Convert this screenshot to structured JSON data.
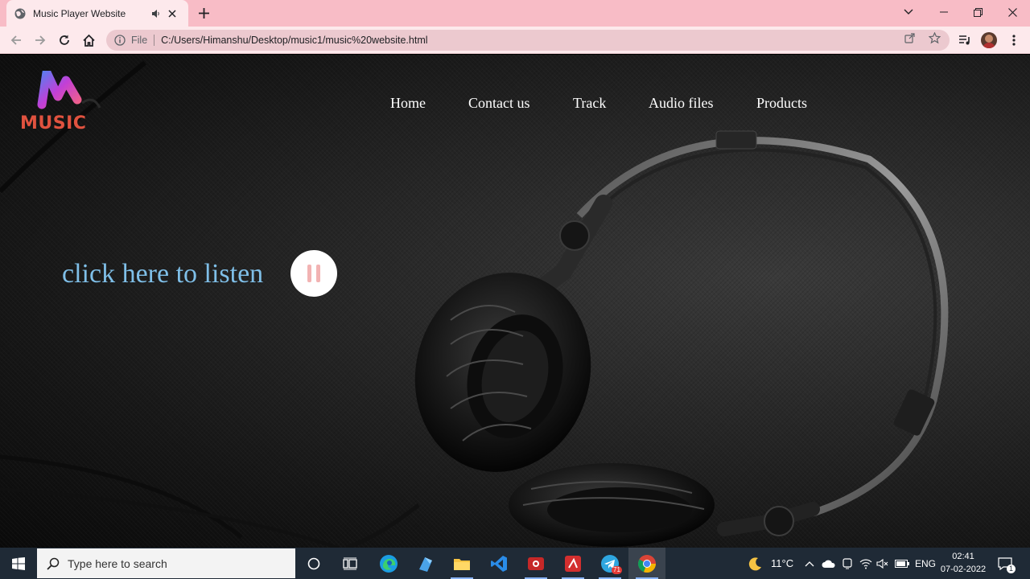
{
  "browser": {
    "tab_title": "Music Player Website",
    "file_label": "File",
    "url": "C:/Users/Himanshu/Desktop/music1/music%20website.html"
  },
  "page": {
    "logo_text": "MUSIC",
    "nav": [
      "Home",
      "Contact us",
      "Track",
      "Audio files",
      "Products"
    ],
    "cta_text": "click here to listen",
    "colors": {
      "cta": "#7fbfe8",
      "logo_text": "#e0523f",
      "chrome": "#f8bcc6"
    }
  },
  "taskbar": {
    "search_placeholder": "Type here to search",
    "weather": "11°C",
    "language": "ENG",
    "time": "02:41",
    "date": "07-02-2022",
    "notification_count": "1",
    "telegram_badge": "71"
  }
}
